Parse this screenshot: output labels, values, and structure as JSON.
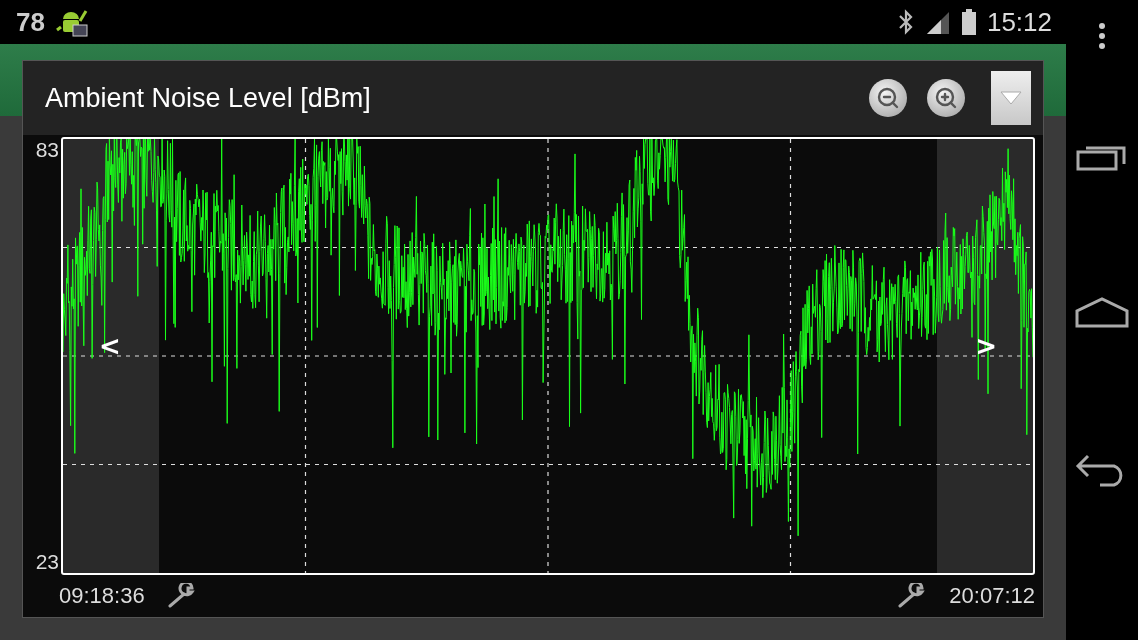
{
  "status_bar": {
    "notification_count": "78",
    "time": "15:12"
  },
  "dialog": {
    "title": "Ambient Noise Level [dBm]",
    "y_max": "83",
    "y_min": "23",
    "left_arrow": "<",
    "right_arrow": ">",
    "start_time": "09:18:36",
    "end_time": "20:07:12"
  }
}
